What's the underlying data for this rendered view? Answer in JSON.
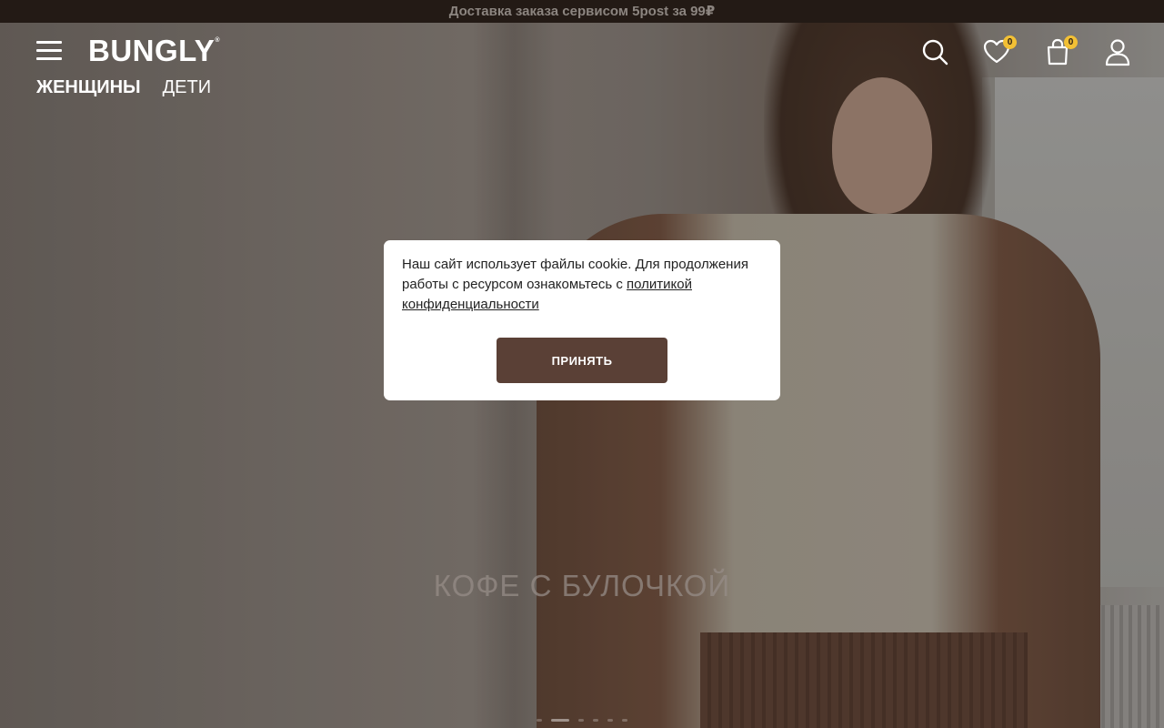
{
  "promo_bar": {
    "text": "Доставка заказа сервисом 5post за 99₽"
  },
  "header": {
    "logo": "BUNGLY",
    "logo_mark": "®",
    "nav": [
      {
        "label": "ЖЕНЩИНЫ",
        "active": true
      },
      {
        "label": "ДЕТИ",
        "active": false
      }
    ],
    "icons": {
      "menu": "hamburger-icon",
      "search": "search-icon",
      "wishlist": "heart-icon",
      "cart": "bag-icon",
      "account": "user-icon"
    },
    "wishlist_count": "0",
    "cart_count": "0"
  },
  "hero": {
    "title": "КОФЕ С БУЛОЧКОЙ",
    "slides_total": 6,
    "active_slide": 1
  },
  "cookie_banner": {
    "text": "Наш сайт использует файлы cookie. Для продолжения работы с ресурсом ознакомьтесь с",
    "link_text": "политикой конфиденциальности",
    "accept_label": "ПРИНЯТЬ"
  },
  "colors": {
    "promo_bg": "#231a15",
    "accept_button": "#5a4036",
    "badge": "#f2c035"
  }
}
